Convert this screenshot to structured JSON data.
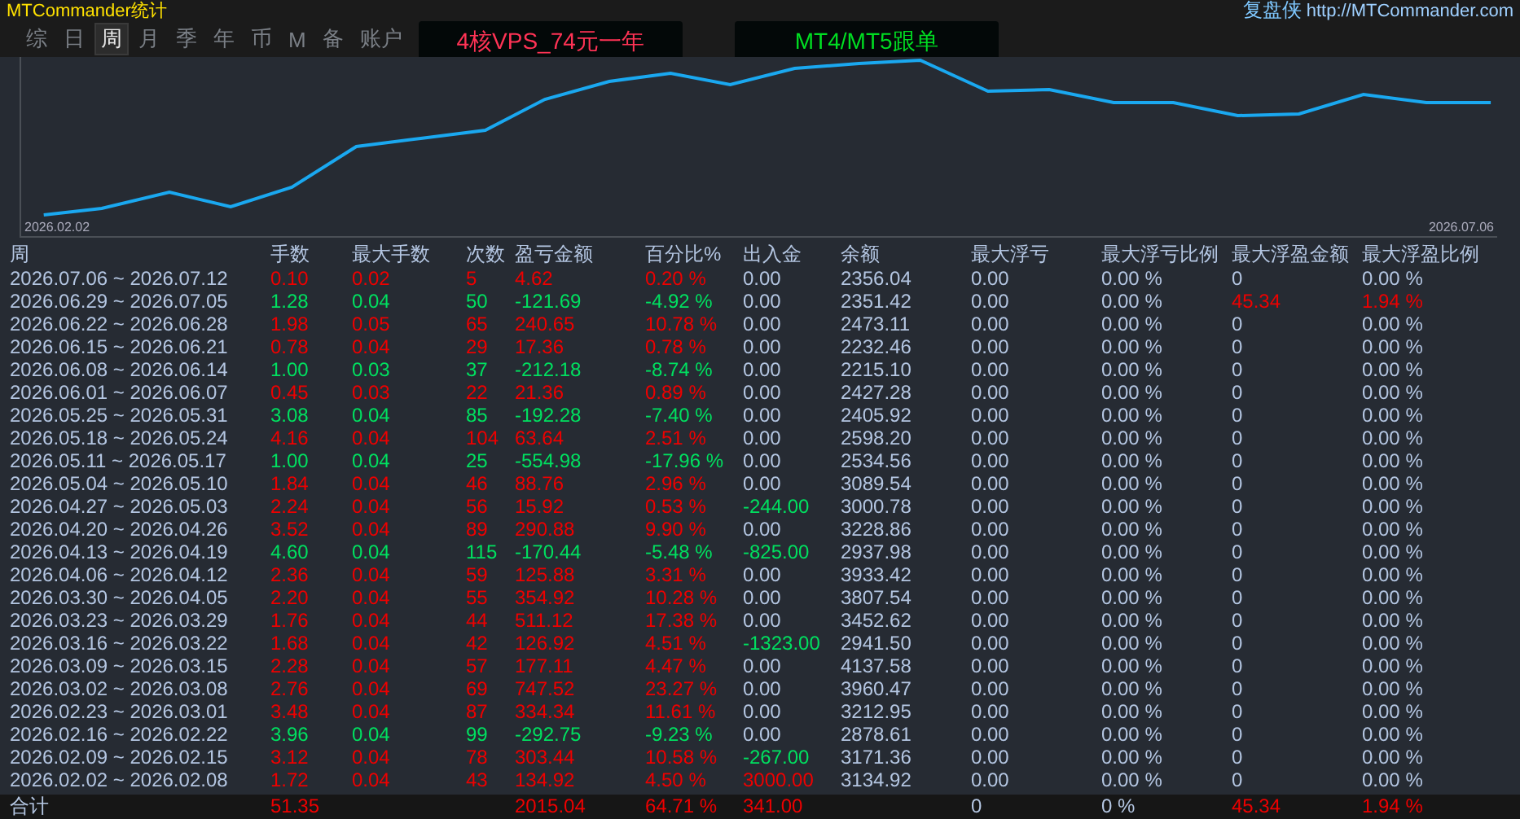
{
  "app_title": "MTCommander统计",
  "header_right": {
    "name": "复盘侠",
    "link": "http://MTCommander.com"
  },
  "tabs": [
    {
      "label": "综",
      "selected": false
    },
    {
      "label": "日",
      "selected": false
    },
    {
      "label": "周",
      "selected": true
    },
    {
      "label": "月",
      "selected": false
    },
    {
      "label": "季",
      "selected": false
    },
    {
      "label": "年",
      "selected": false
    },
    {
      "label": "币",
      "selected": false
    },
    {
      "label": "M",
      "selected": false
    },
    {
      "label": "备",
      "selected": false
    },
    {
      "label": "账户",
      "selected": false
    }
  ],
  "banners": [
    {
      "text": "4核VPS_74元一年",
      "color": "#ff3355"
    },
    {
      "text": "MT4/MT5跟单",
      "color": "#00dd22"
    }
  ],
  "chart": {
    "start_label": "2026.02.02",
    "end_label": "2026.07.06"
  },
  "table": {
    "columns": [
      "周",
      "手数",
      "最大手数",
      "次数",
      "盈亏金额",
      "百分比%",
      "出入金",
      "余额",
      "最大浮亏",
      "最大浮亏比例",
      "最大浮盈金额",
      "最大浮盈比例"
    ],
    "rows": [
      {
        "cells": [
          "2026.07.06 ~ 2026.07.12",
          "0.10",
          "0.02",
          "5",
          "4.62",
          "0.20 %",
          "0.00",
          "2356.04",
          "0.00",
          "0.00 %",
          "0",
          "0.00 %"
        ],
        "loss": false,
        "withdrawal": false,
        "deposit": false,
        "float_profit": false
      },
      {
        "cells": [
          "2026.06.29 ~ 2026.07.05",
          "1.28",
          "0.04",
          "50",
          "-121.69",
          "-4.92 %",
          "0.00",
          "2351.42",
          "0.00",
          "0.00 %",
          "45.34",
          "1.94 %"
        ],
        "loss": true,
        "withdrawal": false,
        "deposit": false,
        "float_profit": true
      },
      {
        "cells": [
          "2026.06.22 ~ 2026.06.28",
          "1.98",
          "0.05",
          "65",
          "240.65",
          "10.78 %",
          "0.00",
          "2473.11",
          "0.00",
          "0.00 %",
          "0",
          "0.00 %"
        ],
        "loss": false,
        "withdrawal": false,
        "deposit": false,
        "float_profit": false
      },
      {
        "cells": [
          "2026.06.15 ~ 2026.06.21",
          "0.78",
          "0.04",
          "29",
          "17.36",
          "0.78 %",
          "0.00",
          "2232.46",
          "0.00",
          "0.00 %",
          "0",
          "0.00 %"
        ],
        "loss": false,
        "withdrawal": false,
        "deposit": false,
        "float_profit": false
      },
      {
        "cells": [
          "2026.06.08 ~ 2026.06.14",
          "1.00",
          "0.03",
          "37",
          "-212.18",
          "-8.74 %",
          "0.00",
          "2215.10",
          "0.00",
          "0.00 %",
          "0",
          "0.00 %"
        ],
        "loss": true,
        "withdrawal": false,
        "deposit": false,
        "float_profit": false
      },
      {
        "cells": [
          "2026.06.01 ~ 2026.06.07",
          "0.45",
          "0.03",
          "22",
          "21.36",
          "0.89 %",
          "0.00",
          "2427.28",
          "0.00",
          "0.00 %",
          "0",
          "0.00 %"
        ],
        "loss": false,
        "withdrawal": false,
        "deposit": false,
        "float_profit": false
      },
      {
        "cells": [
          "2026.05.25 ~ 2026.05.31",
          "3.08",
          "0.04",
          "85",
          "-192.28",
          "-7.40 %",
          "0.00",
          "2405.92",
          "0.00",
          "0.00 %",
          "0",
          "0.00 %"
        ],
        "loss": true,
        "withdrawal": false,
        "deposit": false,
        "float_profit": false
      },
      {
        "cells": [
          "2026.05.18 ~ 2026.05.24",
          "4.16",
          "0.04",
          "104",
          "63.64",
          "2.51 %",
          "0.00",
          "2598.20",
          "0.00",
          "0.00 %",
          "0",
          "0.00 %"
        ],
        "loss": false,
        "withdrawal": false,
        "deposit": false,
        "float_profit": false
      },
      {
        "cells": [
          "2026.05.11 ~ 2026.05.17",
          "1.00",
          "0.04",
          "25",
          "-554.98",
          "-17.96 %",
          "0.00",
          "2534.56",
          "0.00",
          "0.00 %",
          "0",
          "0.00 %"
        ],
        "loss": true,
        "withdrawal": false,
        "deposit": false,
        "float_profit": false
      },
      {
        "cells": [
          "2026.05.04 ~ 2026.05.10",
          "1.84",
          "0.04",
          "46",
          "88.76",
          "2.96 %",
          "0.00",
          "3089.54",
          "0.00",
          "0.00 %",
          "0",
          "0.00 %"
        ],
        "loss": false,
        "withdrawal": false,
        "deposit": false,
        "float_profit": false
      },
      {
        "cells": [
          "2026.04.27 ~ 2026.05.03",
          "2.24",
          "0.04",
          "56",
          "15.92",
          "0.53 %",
          "-244.00",
          "3000.78",
          "0.00",
          "0.00 %",
          "0",
          "0.00 %"
        ],
        "loss": false,
        "withdrawal": true,
        "deposit": false,
        "float_profit": false
      },
      {
        "cells": [
          "2026.04.20 ~ 2026.04.26",
          "3.52",
          "0.04",
          "89",
          "290.88",
          "9.90 %",
          "0.00",
          "3228.86",
          "0.00",
          "0.00 %",
          "0",
          "0.00 %"
        ],
        "loss": false,
        "withdrawal": false,
        "deposit": false,
        "float_profit": false
      },
      {
        "cells": [
          "2026.04.13 ~ 2026.04.19",
          "4.60",
          "0.04",
          "115",
          "-170.44",
          "-5.48 %",
          "-825.00",
          "2937.98",
          "0.00",
          "0.00 %",
          "0",
          "0.00 %"
        ],
        "loss": true,
        "withdrawal": true,
        "deposit": false,
        "float_profit": false
      },
      {
        "cells": [
          "2026.04.06 ~ 2026.04.12",
          "2.36",
          "0.04",
          "59",
          "125.88",
          "3.31 %",
          "0.00",
          "3933.42",
          "0.00",
          "0.00 %",
          "0",
          "0.00 %"
        ],
        "loss": false,
        "withdrawal": false,
        "deposit": false,
        "float_profit": false
      },
      {
        "cells": [
          "2026.03.30 ~ 2026.04.05",
          "2.20",
          "0.04",
          "55",
          "354.92",
          "10.28 %",
          "0.00",
          "3807.54",
          "0.00",
          "0.00 %",
          "0",
          "0.00 %"
        ],
        "loss": false,
        "withdrawal": false,
        "deposit": false,
        "float_profit": false
      },
      {
        "cells": [
          "2026.03.23 ~ 2026.03.29",
          "1.76",
          "0.04",
          "44",
          "511.12",
          "17.38 %",
          "0.00",
          "3452.62",
          "0.00",
          "0.00 %",
          "0",
          "0.00 %"
        ],
        "loss": false,
        "withdrawal": false,
        "deposit": false,
        "float_profit": false
      },
      {
        "cells": [
          "2026.03.16 ~ 2026.03.22",
          "1.68",
          "0.04",
          "42",
          "126.92",
          "4.51 %",
          "-1323.00",
          "2941.50",
          "0.00",
          "0.00 %",
          "0",
          "0.00 %"
        ],
        "loss": false,
        "withdrawal": true,
        "deposit": false,
        "float_profit": false
      },
      {
        "cells": [
          "2026.03.09 ~ 2026.03.15",
          "2.28",
          "0.04",
          "57",
          "177.11",
          "4.47 %",
          "0.00",
          "4137.58",
          "0.00",
          "0.00 %",
          "0",
          "0.00 %"
        ],
        "loss": false,
        "withdrawal": false,
        "deposit": false,
        "float_profit": false
      },
      {
        "cells": [
          "2026.03.02 ~ 2026.03.08",
          "2.76",
          "0.04",
          "69",
          "747.52",
          "23.27 %",
          "0.00",
          "3960.47",
          "0.00",
          "0.00 %",
          "0",
          "0.00 %"
        ],
        "loss": false,
        "withdrawal": false,
        "deposit": false,
        "float_profit": false
      },
      {
        "cells": [
          "2026.02.23 ~ 2026.03.01",
          "3.48",
          "0.04",
          "87",
          "334.34",
          "11.61 %",
          "0.00",
          "3212.95",
          "0.00",
          "0.00 %",
          "0",
          "0.00 %"
        ],
        "loss": false,
        "withdrawal": false,
        "deposit": false,
        "float_profit": false
      },
      {
        "cells": [
          "2026.02.16 ~ 2026.02.22",
          "3.96",
          "0.04",
          "99",
          "-292.75",
          "-9.23 %",
          "0.00",
          "2878.61",
          "0.00",
          "0.00 %",
          "0",
          "0.00 %"
        ],
        "loss": true,
        "withdrawal": false,
        "deposit": false,
        "float_profit": false
      },
      {
        "cells": [
          "2026.02.09 ~ 2026.02.15",
          "3.12",
          "0.04",
          "78",
          "303.44",
          "10.58 %",
          "-267.00",
          "3171.36",
          "0.00",
          "0.00 %",
          "0",
          "0.00 %"
        ],
        "loss": false,
        "withdrawal": true,
        "deposit": false,
        "float_profit": false
      },
      {
        "cells": [
          "2026.02.02 ~ 2026.02.08",
          "1.72",
          "0.04",
          "43",
          "134.92",
          "4.50 %",
          "3000.00",
          "3134.92",
          "0.00",
          "0.00 %",
          "0",
          "0.00 %"
        ],
        "loss": false,
        "withdrawal": false,
        "deposit": true,
        "float_profit": false
      }
    ],
    "total": {
      "cells": [
        "合计",
        "51.35",
        "",
        "",
        "2015.04",
        "64.71 %",
        "341.00",
        "",
        "0",
        "0 %",
        "45.34",
        "1.94 %"
      ],
      "loss": false,
      "withdrawal": false,
      "deposit": true,
      "float_profit": true
    }
  }
}
